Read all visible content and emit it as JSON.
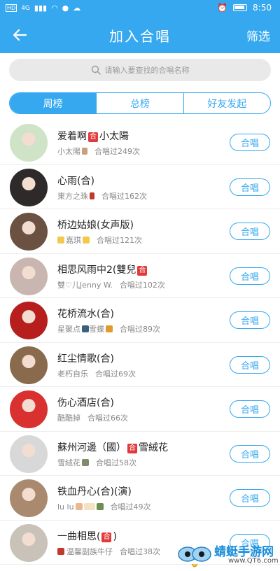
{
  "status_bar": {
    "time": "8:50",
    "network": "HD",
    "speed": "4G"
  },
  "header": {
    "back_icon": "arrow-left-icon",
    "title": "加入合唱",
    "filter": "筛选"
  },
  "search": {
    "placeholder": "请输入要查找的合唱名称",
    "icon": "search-icon"
  },
  "tabs": [
    {
      "label": "周榜",
      "active": true
    },
    {
      "label": "总榜",
      "active": false
    },
    {
      "label": "好友发起",
      "active": false
    }
  ],
  "chorus_badge": "合",
  "join_label": "合唱",
  "items": [
    {
      "song": "爱着啊",
      "song_suffix": "小太陽",
      "user": "小太陽",
      "count": "合唱过249次",
      "avatar_color": "#cfe3c7"
    },
    {
      "song": "心雨(合)",
      "song_suffix": "",
      "user": "東方之珠",
      "count": "合唱过162次",
      "avatar_color": "#2e2a2a"
    },
    {
      "song": "桥边姑娘(女声版)",
      "song_suffix": "",
      "user": "嘉琪",
      "count": "合唱过121次",
      "avatar_color": "#6b5142"
    },
    {
      "song": "相思风雨中2(雙兒",
      "song_suffix": "",
      "user": "雙♡儿Jenny W.",
      "count": "合唱过102次",
      "avatar_color": "#c9b6b0"
    },
    {
      "song": "花桥流水(合)",
      "song_suffix": "",
      "user": "星聚点",
      "count": "合唱过89次",
      "avatar_color": "#b71f1f"
    },
    {
      "song": "红尘情歌(合)",
      "song_suffix": "",
      "user": "老朽自乐",
      "count": "合唱过69次",
      "avatar_color": "#8a6a4c"
    },
    {
      "song": "伤心酒店(合)",
      "song_suffix": "",
      "user": "酷酷掉",
      "count": "合唱过66次",
      "avatar_color": "#d93030"
    },
    {
      "song": "蘇州河邊（國）",
      "song_suffix": "雪絨花",
      "user": "雪絨花",
      "count": "合唱过58次",
      "avatar_color": "#d8d8d8"
    },
    {
      "song": "铁血丹心(合)(演)",
      "song_suffix": "",
      "user": "lu lu",
      "count": "合唱过49次",
      "avatar_color": "#a98a6f"
    },
    {
      "song": "一曲相思(",
      "song_suffix": ")",
      "user": "温馨副族牛仔",
      "count": "合唱过38次",
      "avatar_color": "#c8c2b8"
    }
  ],
  "watermark": {
    "text": "蜻蜓手游网",
    "url": "www.QT6.com"
  }
}
